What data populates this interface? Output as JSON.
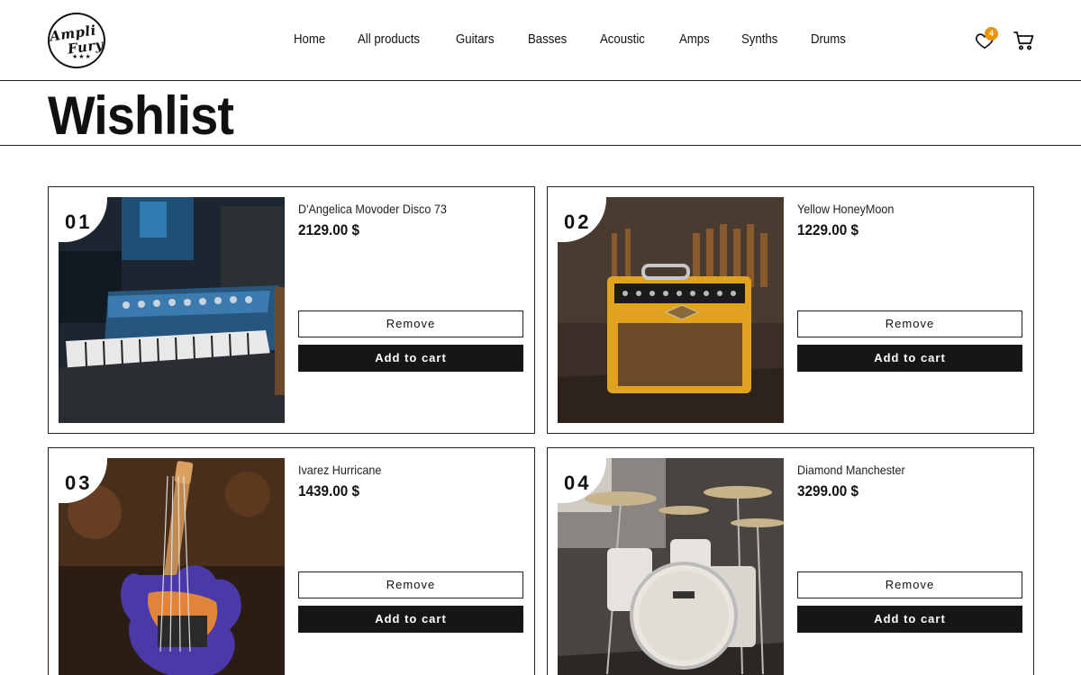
{
  "brand": {
    "line1": "Ampli",
    "line2": "Fury",
    "stars": "★★★"
  },
  "nav": [
    "Home",
    "All products",
    "Guitars",
    "Basses",
    "Acoustic",
    "Amps",
    "Synths",
    "Drums"
  ],
  "header": {
    "wishlist_count": "4"
  },
  "page": {
    "title": "Wishlist"
  },
  "wishlist": [
    {
      "number": "01",
      "name": "D'Angelica Movoder Disco 73",
      "price": "2129.00 $",
      "remove_label": "Remove",
      "add_label": "Add to cart"
    },
    {
      "number": "02",
      "name": "Yellow HoneyMoon",
      "price": "1229.00 $",
      "remove_label": "Remove",
      "add_label": "Add to cart"
    },
    {
      "number": "03",
      "name": "Ivarez Hurricane",
      "price": "1439.00 $",
      "remove_label": "Remove",
      "add_label": "Add to cart"
    },
    {
      "number": "04",
      "name": "Diamond Manchester",
      "price": "3299.00 $",
      "remove_label": "Remove",
      "add_label": "Add to cart"
    }
  ],
  "colors": {
    "accent": "#f39200",
    "button_dark": "#161616",
    "border": "#222222"
  }
}
